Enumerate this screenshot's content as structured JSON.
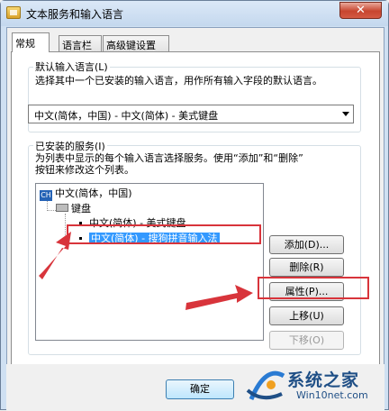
{
  "window": {
    "title": "文本服务和输入语言",
    "close_glyph": "✕"
  },
  "tabs": [
    {
      "label": "常规",
      "active": true
    },
    {
      "label": "语言栏",
      "active": false
    },
    {
      "label": "高级键设置",
      "active": false
    }
  ],
  "default_language": {
    "legend": "默认输入语言(L)",
    "description": "选择其中一个已安装的输入语言，用作所有输入字段的默认语言。",
    "selected": "中文(简体，中国) - 中文(简体) - 美式键盘"
  },
  "installed_services": {
    "legend": "已安装的服务(I)",
    "description_line1": "为列表中显示的每个输入语言选择服务。使用“添加”和“删除”",
    "description_line2": "按钮来修改这个列表。",
    "tree": {
      "language_badge": "CH",
      "language": "中文(简体，中国)",
      "category": "键盘",
      "items": [
        {
          "label": "中文(简体) - 美式键盘",
          "selected": false
        },
        {
          "label": "中文(简体) - 搜狗拼音输入法",
          "selected": true
        }
      ]
    },
    "buttons": {
      "add": "添加(D)...",
      "remove": "删除(R)",
      "properties": "属性(P)...",
      "move_up": "上移(U)",
      "move_down": "下移(O)"
    }
  },
  "footer": {
    "ok": "确定"
  },
  "watermark": {
    "main": "系统之家",
    "sub": "Win10net.com"
  },
  "colors": {
    "annotation": "#d8343b",
    "selection": "#3399ff",
    "watermark": "#1f4f86"
  }
}
